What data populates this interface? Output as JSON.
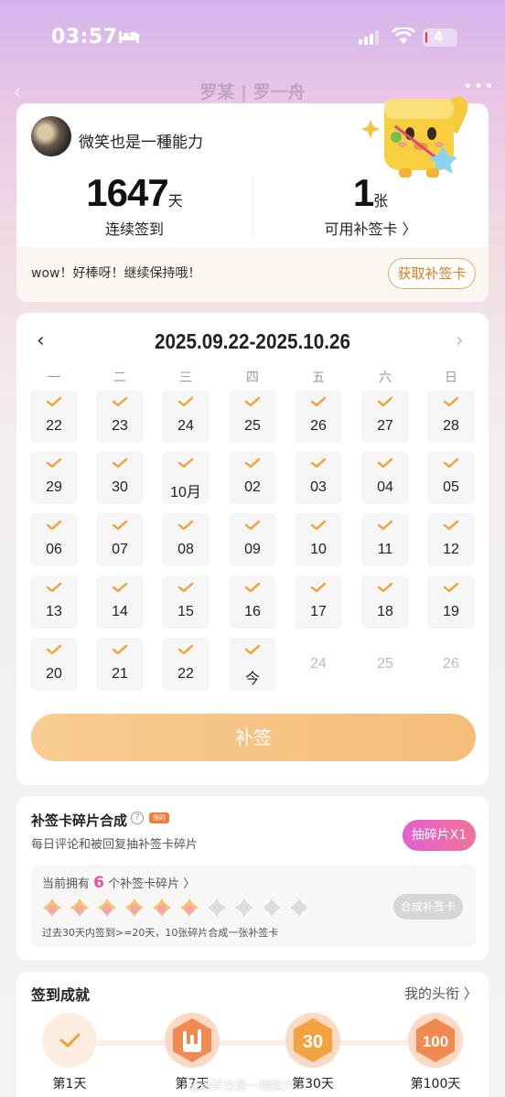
{
  "status_bar": {
    "time": "03:57",
    "battery": "4"
  },
  "nav": {
    "title": "罗某 | 罗一舟"
  },
  "user": {
    "name": "微笑也是一種能力"
  },
  "stats": {
    "consecutive_days": "1647",
    "consecutive_unit": "天",
    "consecutive_label": "连续签到",
    "cards": "1",
    "cards_unit": "张",
    "cards_label": "可用补签卡 〉"
  },
  "encourage": {
    "text": "wow！好棒呀！继续保持哦！",
    "button": "获取补签卡"
  },
  "calendar": {
    "range": "2025.09.22-2025.10.26",
    "weekdays": [
      "一",
      "二",
      "三",
      "四",
      "五",
      "六",
      "日"
    ],
    "days": [
      {
        "label": "22",
        "checked": true
      },
      {
        "label": "23",
        "checked": true
      },
      {
        "label": "24",
        "checked": true
      },
      {
        "label": "25",
        "checked": true
      },
      {
        "label": "26",
        "checked": true
      },
      {
        "label": "27",
        "checked": true
      },
      {
        "label": "28",
        "checked": true
      },
      {
        "label": "29",
        "checked": true
      },
      {
        "label": "30",
        "checked": true
      },
      {
        "label": "10月",
        "checked": true
      },
      {
        "label": "02",
        "checked": true
      },
      {
        "label": "03",
        "checked": true
      },
      {
        "label": "04",
        "checked": true
      },
      {
        "label": "05",
        "checked": true
      },
      {
        "label": "06",
        "checked": true
      },
      {
        "label": "07",
        "checked": true
      },
      {
        "label": "08",
        "checked": true
      },
      {
        "label": "09",
        "checked": true
      },
      {
        "label": "10",
        "checked": true
      },
      {
        "label": "11",
        "checked": true
      },
      {
        "label": "12",
        "checked": true
      },
      {
        "label": "13",
        "checked": true
      },
      {
        "label": "14",
        "checked": true
      },
      {
        "label": "15",
        "checked": true
      },
      {
        "label": "16",
        "checked": true
      },
      {
        "label": "17",
        "checked": true
      },
      {
        "label": "18",
        "checked": true
      },
      {
        "label": "19",
        "checked": true
      },
      {
        "label": "20",
        "checked": true
      },
      {
        "label": "21",
        "checked": true
      },
      {
        "label": "22",
        "checked": true
      },
      {
        "label": "今",
        "checked": true
      },
      {
        "label": "24",
        "checked": false
      },
      {
        "label": "25",
        "checked": false
      },
      {
        "label": "26",
        "checked": false
      }
    ],
    "makeup_button": "补签"
  },
  "fragments": {
    "title": "补签卡碎片合成",
    "badge": "限时",
    "subtitle": "每日评论和被回复抽补签卡碎片",
    "draw_button": "抽碎片X1",
    "own_prefix": "当前拥有",
    "own_count": "6",
    "own_suffix": "个补签卡碎片 〉",
    "owned": 6,
    "total": 10,
    "compose_button": "合成补签卡",
    "rule": "过去30天内签到>=20天，10张碎片合成一张补签卡"
  },
  "achievements": {
    "title": "签到成就",
    "link": "我的头衔 〉",
    "items": [
      {
        "label": "第1天"
      },
      {
        "label": "第7天"
      },
      {
        "label": "第30天"
      },
      {
        "label": "第100天"
      }
    ]
  },
  "watermark": "@微笑也是一種能力",
  "colors": {
    "accent": "#f0a035",
    "pink": "#ee4ea0",
    "button": "#f7c78a"
  }
}
